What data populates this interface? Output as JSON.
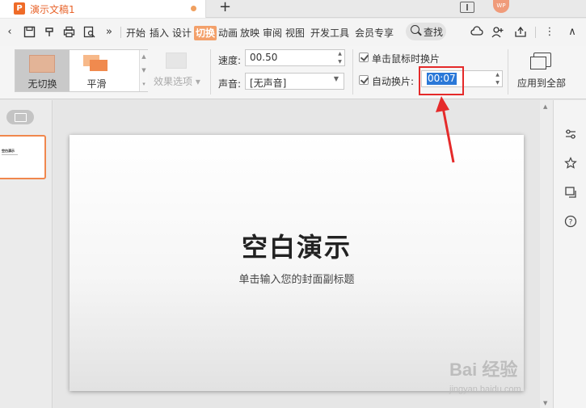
{
  "titlebar": {
    "logo_letter": "P",
    "doc_title": "演示文稿1",
    "new_tab": "+",
    "avatar": "WP"
  },
  "toolbar": {
    "more": "»",
    "tabs": [
      "开始",
      "插入",
      "设计",
      "切换",
      "动画",
      "放映",
      "审阅",
      "视图",
      "开发工具",
      "会员专享"
    ],
    "active_tab": "切换",
    "search_label": "查找",
    "more_menu": "⋮",
    "collapse": "∧"
  },
  "ribbon": {
    "transitions": [
      {
        "label": "无切换",
        "selected": true
      },
      {
        "label": "平滑",
        "selected": false
      }
    ],
    "effect_options": "效果选项",
    "speed_label": "速度:",
    "speed_value": "00.50",
    "sound_label": "声音:",
    "sound_value": "[无声音]",
    "on_click_label": "单击鼠标时换片",
    "on_click_checked": true,
    "auto_label": "自动换片:",
    "auto_checked": true,
    "auto_value": "00:07",
    "apply_all": "应用到全部"
  },
  "slide": {
    "title": "空白演示",
    "subtitle": "单击输入您的封面副标题",
    "thumb_title": "空白演示"
  },
  "watermark": {
    "brand": "Bai 经验",
    "url": "jingyan.baidu.com"
  },
  "colors": {
    "accent": "#f3a06a",
    "annotation": "#e52a2a",
    "selection": "#2a78d8"
  }
}
